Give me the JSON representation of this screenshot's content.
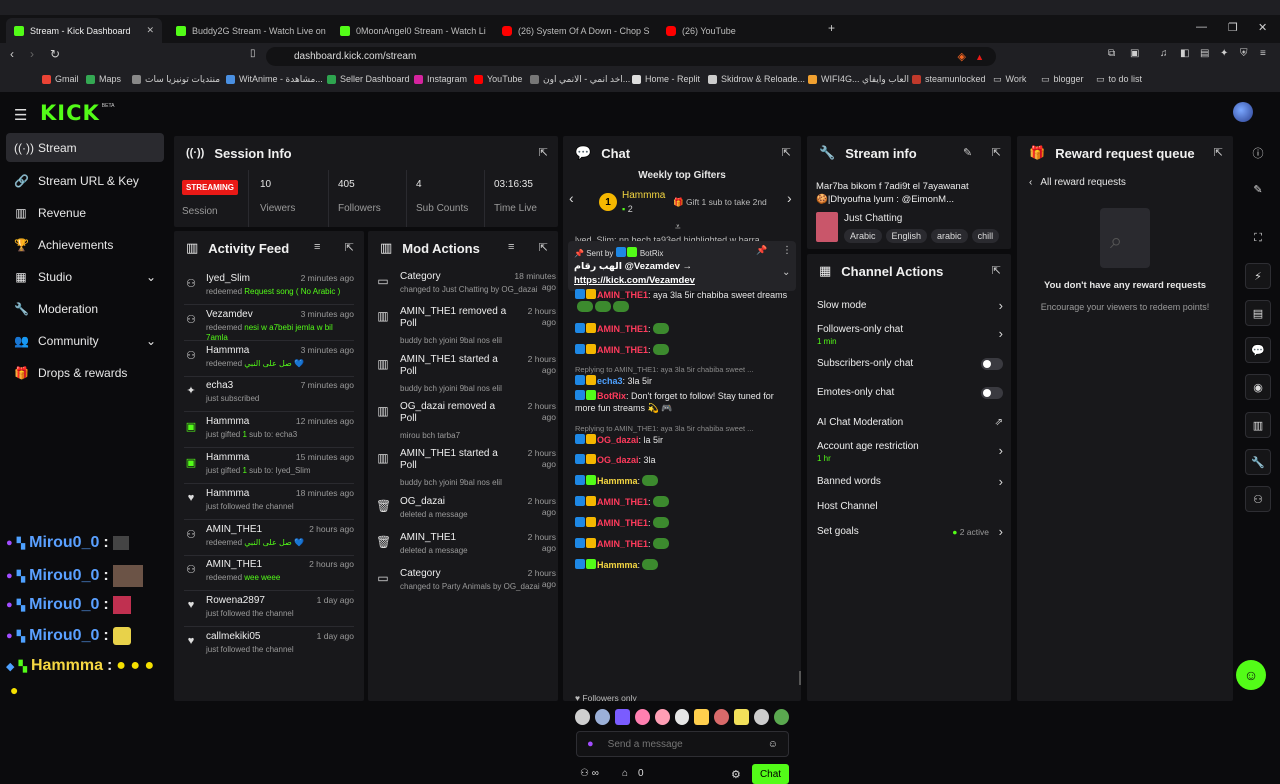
{
  "browser": {
    "tabs": [
      {
        "label": "Stream - Kick Dashboard",
        "icon": "kick"
      },
      {
        "label": "Buddy2G Stream - Watch Live on",
        "icon": "kick"
      },
      {
        "label": "0MoonAngel0 Stream - Watch Li",
        "icon": "kick"
      },
      {
        "label": "(26) System Of A Down - Chop S",
        "icon": "youtube"
      },
      {
        "label": "(26) YouTube",
        "icon": "youtube"
      }
    ],
    "url": "dashboard.kick.com/stream",
    "bookmarks": [
      "Gmail",
      "Maps",
      "منتديات تونيزيا سات",
      "WitAnime - مشاهدة...",
      "Seller Dashboard",
      "Instagram",
      "YouTube",
      "اخد انمي - الانمي اون...",
      "Home - Replit",
      "Skidrow & Reloade...",
      "WIFI4G... العاب وايفاي",
      "steamunlocked",
      "Work",
      "blogger",
      "to do list"
    ]
  },
  "logo": {
    "text": "KICK",
    "beta": "BETA"
  },
  "sidebar": {
    "items": [
      {
        "label": "Stream",
        "icon": "broadcast-icon"
      },
      {
        "label": "Stream URL & Key",
        "icon": "link-icon"
      },
      {
        "label": "Revenue",
        "icon": "chart-icon"
      },
      {
        "label": "Achievements",
        "icon": "trophy-icon"
      },
      {
        "label": "Studio",
        "icon": "grid-icon"
      },
      {
        "label": "Moderation",
        "icon": "wrench-icon"
      },
      {
        "label": "Community",
        "icon": "people-icon"
      },
      {
        "label": "Drops & rewards",
        "icon": "gift-icon"
      }
    ]
  },
  "session": {
    "title": "Session Info",
    "status": "STREAMING",
    "status_label": "Session",
    "stats": [
      {
        "value": "10",
        "label": "Viewers"
      },
      {
        "value": "405",
        "label": "Followers"
      },
      {
        "value": "4",
        "label": "Sub Counts"
      },
      {
        "value": "03:16:35",
        "label": "Time Live"
      }
    ]
  },
  "activity": {
    "title": "Activity Feed",
    "rows": [
      {
        "name": "Iyed_Slim",
        "time": "2 minutes ago",
        "pre": "redeemed ",
        "hl": "Request song ( No Arabic )",
        "post": ""
      },
      {
        "name": "Vezamdev",
        "time": "3 minutes ago",
        "pre": "redeemed ",
        "hl": "nesi w a7bebi jemla w bil 7amla",
        "post": ""
      },
      {
        "name": "Hammma",
        "time": "3 minutes ago",
        "pre": "redeemed ",
        "hl": "صل على النبي",
        "post": " 💙"
      },
      {
        "name": "echa3",
        "time": "7 minutes ago",
        "pre": "just subscribed",
        "hl": "",
        "post": ""
      },
      {
        "name": "Hammma",
        "time": "12 minutes ago",
        "pre": "just gifted ",
        "hl": "1",
        "post": " sub to: echa3"
      },
      {
        "name": "Hammma",
        "time": "15 minutes ago",
        "pre": "just gifted ",
        "hl": "1",
        "post": " sub to: Iyed_Slim"
      },
      {
        "name": "Hammma",
        "time": "18 minutes ago",
        "pre": "just followed the channel",
        "hl": "",
        "post": ""
      },
      {
        "name": "AMIN_THE1",
        "time": "2 hours ago",
        "pre": "redeemed ",
        "hl": "صل على النبي",
        "post": " 💙"
      },
      {
        "name": "AMIN_THE1",
        "time": "2 hours ago",
        "pre": "redeemed ",
        "hl": "wee weee",
        "post": ""
      },
      {
        "name": "Rowena2897",
        "time": "1 day ago",
        "pre": "just followed the channel",
        "hl": "",
        "post": ""
      },
      {
        "name": "callmekiki05",
        "time": "1 day ago",
        "pre": "just followed the channel",
        "hl": "",
        "post": ""
      }
    ]
  },
  "mod": {
    "title": "Mod Actions",
    "rows": [
      {
        "title": "Category",
        "time": "18 minutes ago",
        "desc": "changed to Just Chatting by OG_dazai"
      },
      {
        "title": "AMIN_THE1 removed a Poll",
        "time": "2 hours ago",
        "desc": "buddy bch yjoini 9bal nos elil"
      },
      {
        "title": "AMIN_THE1 started a Poll",
        "time": "2 hours ago",
        "desc": "buddy bch yjoini 9bal nos elil"
      },
      {
        "title": "OG_dazai removed a Poll",
        "time": "2 hours ago",
        "desc": "mirou bch tarba7"
      },
      {
        "title": "AMIN_THE1 started a Poll",
        "time": "2 hours ago",
        "desc": "buddy bch yjoini 9bal nos elil"
      },
      {
        "title": "OG_dazai",
        "time": "2 hours ago",
        "desc": "deleted a message"
      },
      {
        "title": "AMIN_THE1",
        "time": "2 hours ago",
        "desc": "deleted a message"
      },
      {
        "title": "Category",
        "time": "2 hours ago",
        "desc": "changed to Party Animals by OG_dazai"
      }
    ]
  },
  "chat": {
    "title": "Chat",
    "gifters_title": "Weekly top Gifters",
    "top_gifter": "Hammma",
    "top_gifter_count": "2",
    "gift_hint": "Gift 1 sub to take 2nd",
    "pinned_header": "Sent by",
    "pinned_by": "BotRix",
    "pinned_text": "الهب رقام @Vezamdev →",
    "pinned_link": "https://kick.com/Vezamdev",
    "cut_text": "lyed_Slim: nn bech ta93ed highlighted w barra",
    "messages": [
      {
        "user": "AMIN_THE1",
        "text": ": aya 3la 5ir chabiba sweet dreams"
      },
      {
        "user": "AMIN_THE1",
        "text": ":"
      },
      {
        "user": "AMIN_THE1",
        "text": ":"
      },
      {
        "reply": "Replying to AMIN_THE1: aya 3la 5ir chabiba sweet ..."
      },
      {
        "user": "echa3",
        "text": ": 3la 5ir"
      },
      {
        "user": "BotRix",
        "text": ": Don't forget to follow! Stay tuned for more fun streams 💫 🎮"
      },
      {
        "reply": "Replying to AMIN_THE1: aya 3la 5ir chabiba sweet ..."
      },
      {
        "user": "OG_dazai",
        "text": ": la 5ir"
      },
      {
        "user": "OG_dazai",
        "text": ": 3la"
      },
      {
        "user": "Hammma",
        "text": ":"
      },
      {
        "user": "AMIN_THE1",
        "text": ":"
      },
      {
        "user": "AMIN_THE1",
        "text": ":"
      },
      {
        "user": "AMIN_THE1",
        "text": ":"
      },
      {
        "user": "Hammma",
        "text": ":"
      }
    ],
    "followers_only": "Followers only",
    "placeholder": "Send a message",
    "points": "0",
    "send": "Chat"
  },
  "stream_info": {
    "title": "Stream info",
    "stream_title": "Mar7ba bikom f 7adi9t el 7ayawanat 🍪|Dhyoufna lyum : @EimonM...",
    "category": "Just Chatting",
    "tags": [
      "Arabic",
      "English",
      "arabic",
      "chill"
    ]
  },
  "channel_actions": {
    "title": "Channel Actions",
    "rows": [
      {
        "label": "Slow mode",
        "sub": "",
        "control": "chevron"
      },
      {
        "label": "Followers-only chat",
        "sub": "1 min",
        "control": "chevron"
      },
      {
        "label": "Subscribers-only chat",
        "sub": "",
        "control": "toggle"
      },
      {
        "label": "Emotes-only chat",
        "sub": "",
        "control": "toggle"
      },
      {
        "label": "AI Chat Moderation",
        "sub": "",
        "control": "external"
      },
      {
        "label": "Account age restriction",
        "sub": "1 hr",
        "control": "chevron"
      },
      {
        "label": "Banned words",
        "sub": "",
        "control": "chevron"
      },
      {
        "label": "Host Channel",
        "sub": "",
        "control": "none"
      },
      {
        "label": "Set goals",
        "sub": "",
        "control": "chevron",
        "status": "2 active"
      }
    ]
  },
  "rewards": {
    "title": "Reward request queue",
    "back": "All reward requests",
    "empty_title": "You don't have any reward requests",
    "empty_desc": "Encourage your viewers to redeem points!"
  },
  "overlay": {
    "lines": [
      {
        "name": "Mirou0_0",
        "sep": ":"
      },
      {
        "name": "Mirou0_0",
        "sep": ":"
      },
      {
        "name": "Mirou0_0",
        "sep": ":"
      },
      {
        "name": "Mirou0_0",
        "sep": ":"
      },
      {
        "name": "Hammma",
        "sep": ":"
      }
    ]
  },
  "colors": {
    "accent": "#53fc18",
    "live": "#e91916",
    "panel": "#18181b"
  }
}
